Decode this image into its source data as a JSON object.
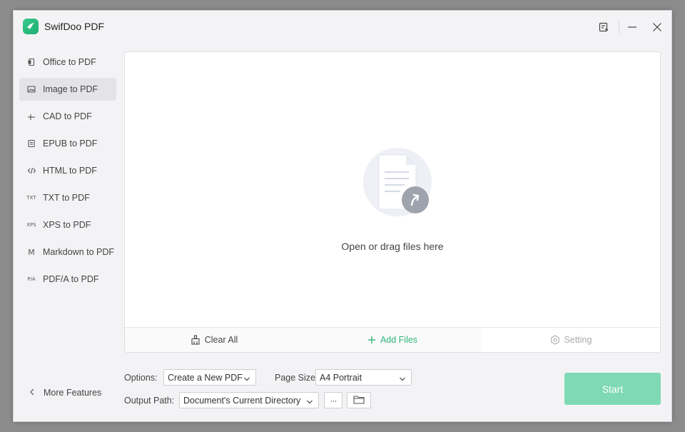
{
  "app": {
    "title": "SwifDoo PDF"
  },
  "colors": {
    "accent": "#2fb57a",
    "start_button": "#7fd9b4",
    "active_item": "#e4e4e8"
  },
  "sidebar": {
    "items": [
      {
        "label": "Office to PDF",
        "icon": "office-icon"
      },
      {
        "label": "Image to PDF",
        "icon": "image-icon"
      },
      {
        "label": "CAD to PDF",
        "icon": "cad-icon"
      },
      {
        "label": "EPUB to PDF",
        "icon": "epub-icon"
      },
      {
        "label": "HTML to PDF",
        "icon": "html-icon"
      },
      {
        "label": "TXT to PDF",
        "icon": "txt-icon",
        "glyph": "TXT"
      },
      {
        "label": "XPS to PDF",
        "icon": "xps-icon",
        "glyph": "XPS"
      },
      {
        "label": "Markdown to PDF",
        "icon": "markdown-icon",
        "glyph": "M"
      },
      {
        "label": "PDF/A to PDF",
        "icon": "pdfa-icon",
        "glyph": "P/A"
      }
    ],
    "active_index": 1,
    "more_features": "More Features"
  },
  "drop_area": {
    "text": "Open or drag files here",
    "clear_all": "Clear All",
    "add_files": "Add Files",
    "setting": "Setting"
  },
  "options": {
    "options_label": "Options:",
    "options_value": "Create a New PDF",
    "page_size_label": "Page Size:",
    "page_size_value": "A4 Portrait",
    "output_path_label": "Output Path:",
    "output_path_value": "Document's Current Directory",
    "more_glyph": "···"
  },
  "start_button": "Start"
}
